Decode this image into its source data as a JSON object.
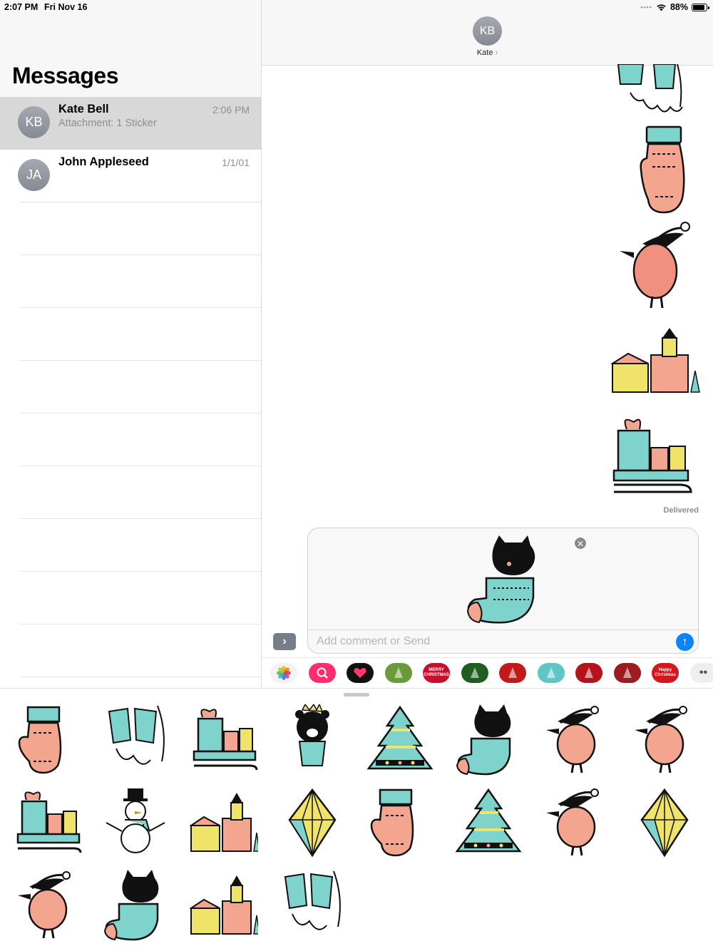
{
  "status_bar": {
    "time": "2:07 PM",
    "date": "Fri Nov 16",
    "battery": "88%",
    "wifi_icon": "wifi-icon",
    "battery_level": 0.88
  },
  "messages": {
    "title": "Messages",
    "conversations": [
      {
        "initials": "KB",
        "name": "Kate Bell",
        "preview": "Attachment: 1 Sticker",
        "date": "2:06 PM",
        "selected": true
      },
      {
        "initials": "JA",
        "name": "John Appleseed",
        "preview": "",
        "date": "1/1/01",
        "selected": false
      }
    ]
  },
  "chat": {
    "contact_initials": "KB",
    "contact_name": "Kate",
    "contact_chevron": "›",
    "sent_stickers": [
      "mittens-sticker",
      "mitten-sticker",
      "bird-sticker",
      "village-sticker",
      "sleigh-sticker"
    ],
    "delivered_label": "Delivered",
    "compose": {
      "sticker": "cat-stocking-sticker",
      "remove_symbol": "✕",
      "placeholder": "Add comment or Send",
      "send_symbol": "↑"
    },
    "expand_symbol": "›"
  },
  "app_strip": [
    {
      "icon": "photos-app-icon",
      "color": "#f2f2f2"
    },
    {
      "icon": "search-images-app-icon",
      "color": "#ff2d6f"
    },
    {
      "icon": "digital-touch-app-icon",
      "color": "#111111"
    },
    {
      "icon": "christmas-wreath-app-icon",
      "color": "#6a9a3a"
    },
    {
      "icon": "merry-christmas-app-icon",
      "color": "#c8102e",
      "label": "MERRY CHRISTMAS"
    },
    {
      "icon": "christmas-tree-app-icon",
      "color": "#1f5e1f"
    },
    {
      "icon": "red-tree-app-icon",
      "color": "#c21a1a"
    },
    {
      "icon": "santa-app-icon",
      "color": "#5ec6c4"
    },
    {
      "icon": "reindeer-app-icon",
      "color": "#b3131a"
    },
    {
      "icon": "ornament-app-icon",
      "color": "#9e1b20"
    },
    {
      "icon": "happy-christmas-app-icon",
      "color": "#d6161f",
      "label": "Happy Christmas"
    },
    {
      "icon": "more-apps-icon",
      "color": "#eeeeee"
    }
  ],
  "drawer_stickers": [
    "mitten-sticker",
    "mittens-sticker",
    "sleigh-sticker",
    "bear-sticker",
    "tree-sticker",
    "cat-stocking-sticker",
    "bird-sticker",
    "bird-sticker",
    "sleigh-sticker",
    "snowman-sticker",
    "village-sticker",
    "crystal-sticker",
    "mitten-sticker",
    "tree-sticker",
    "bird-sticker",
    "crystal-sticker",
    "bird-sticker",
    "cat-stocking-sticker",
    "village-sticker",
    "mittens-sticker"
  ]
}
